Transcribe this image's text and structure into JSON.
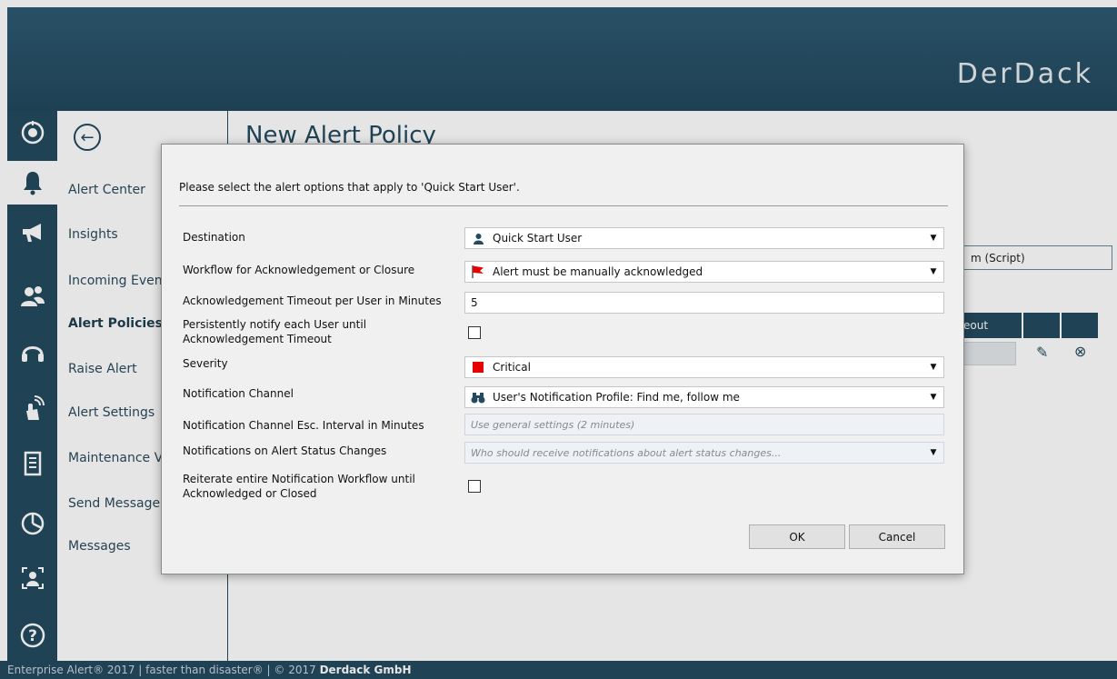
{
  "header": {
    "logo": "DerDack"
  },
  "rail": {
    "icons": [
      "sync-icon",
      "bell-icon",
      "megaphone-icon",
      "users-icon",
      "headset-icon",
      "touch-icon",
      "document-icon",
      "pie-chart-icon",
      "person-scan-icon",
      "help-icon"
    ],
    "active": "bell-icon"
  },
  "nav": {
    "items": [
      {
        "label": "Alert Center",
        "bold": false
      },
      {
        "label": "Insights",
        "bold": false
      },
      {
        "label": "Incoming Even",
        "bold": false
      },
      {
        "label": "Alert Policies",
        "bold": true
      },
      {
        "label": "Raise Alert",
        "bold": false
      },
      {
        "label": "Alert Settings",
        "bold": false
      },
      {
        "label": "Maintenance V",
        "bold": false
      },
      {
        "label": "Send Message",
        "bold": false
      },
      {
        "label": "Messages",
        "bold": false
      }
    ]
  },
  "main": {
    "title": "New Alert Policy",
    "script_label": "m (Script)",
    "table_header": "eout"
  },
  "dialog": {
    "intro": "Please select the alert options that apply to 'Quick Start User'.",
    "destination": {
      "label": "Destination",
      "value": "Quick Start User"
    },
    "workflow": {
      "label": "Workflow for Acknowledgement or Closure",
      "value": "Alert must be manually acknowledged"
    },
    "ack_timeout": {
      "label": "Acknowledgement Timeout per User in Minutes",
      "value": "5"
    },
    "persist": {
      "label": "Persistently notify each User until Acknowledgement Timeout",
      "checked": false
    },
    "severity": {
      "label": "Severity",
      "value": "Critical",
      "color": "#e60000"
    },
    "channel": {
      "label": "Notification Channel",
      "value": "User's Notification Profile: Find me, follow me"
    },
    "channel_interval": {
      "label": "Notification Channel Esc. Interval in Minutes",
      "placeholder": "Use general settings (2 minutes)"
    },
    "status_changes": {
      "label": "Notifications on Alert Status Changes",
      "placeholder": "Who should receive notifications about alert status changes..."
    },
    "reiterate": {
      "label": "Reiterate entire Notification Workflow until Acknowledged or Closed",
      "checked": false
    },
    "ok": "OK",
    "cancel": "Cancel"
  },
  "footer": {
    "text": "Enterprise Alert® 2017  | faster than disaster® | © 2017 ",
    "company": "Derdack GmbH"
  }
}
